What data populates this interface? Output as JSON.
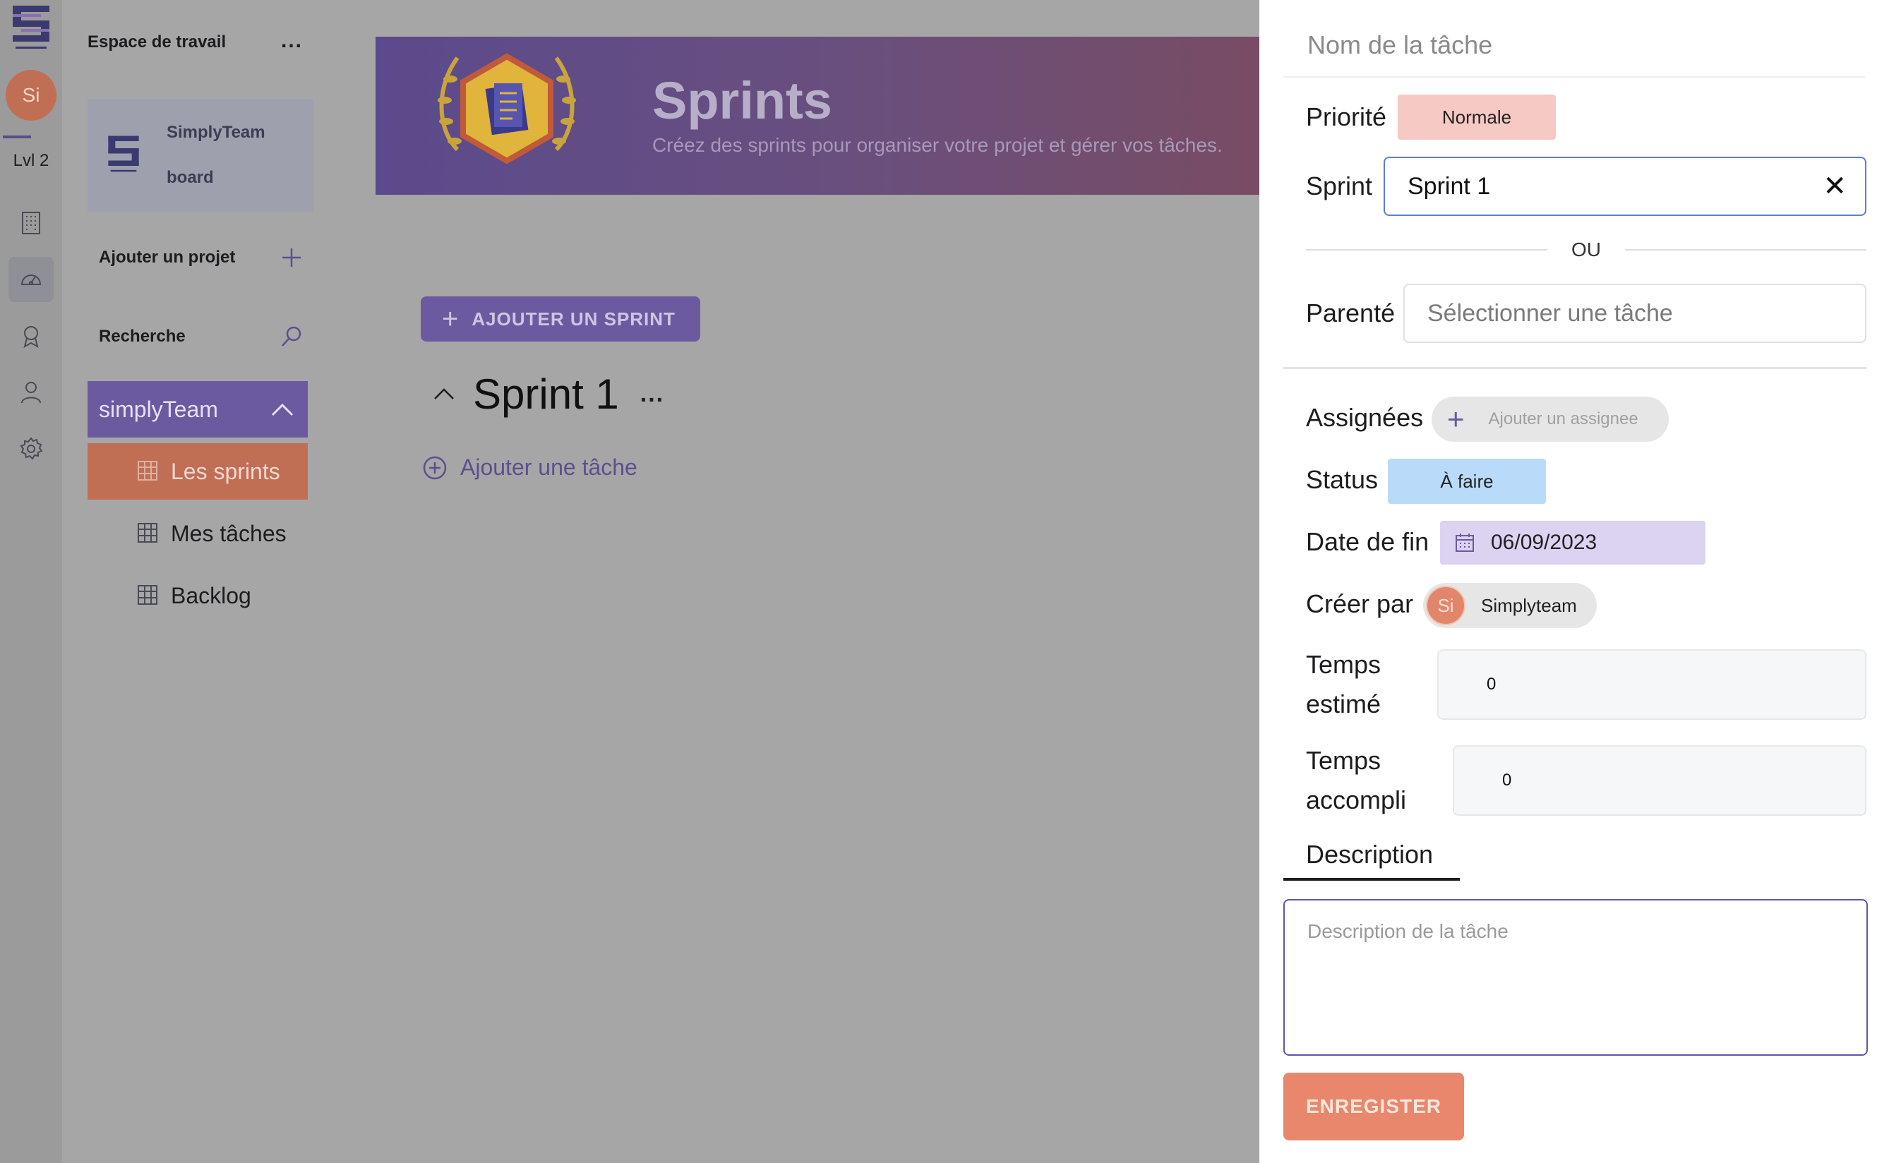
{
  "rail": {
    "avatar_initials": "Si",
    "level": "Lvl 2"
  },
  "sidebar": {
    "workspace_title": "Espace de travail",
    "workspace_menu": "...",
    "board": {
      "name_line1": "SimplyTeam",
      "name_line2": "board"
    },
    "add_project": "Ajouter un projet",
    "search": "Recherche",
    "team": "simplyTeam",
    "items": [
      {
        "label": "Les sprints",
        "active": true
      },
      {
        "label": "Mes tâches",
        "active": false
      },
      {
        "label": "Backlog",
        "active": false
      }
    ]
  },
  "main": {
    "banner_title": "Sprints",
    "banner_subtitle": "Créez des sprints pour organiser votre projet et gérer vos tâches.",
    "add_sprint_label": "AJOUTER UN SPRINT",
    "sprint_name": "Sprint 1",
    "sprint_menu": "...",
    "add_task_label": "Ajouter une tâche"
  },
  "drawer": {
    "task_name_placeholder": "Nom de la tâche",
    "priority_label": "Priorité",
    "priority_value": "Normale",
    "sprint_label": "Sprint",
    "sprint_value": "Sprint 1",
    "clear_symbol": "✕",
    "or_text": "OU",
    "parent_label": "Parenté",
    "parent_placeholder": "Sélectionner une tâche",
    "assignees_label": "Assignées",
    "add_assignee": "Ajouter un assignee",
    "status_label": "Status",
    "status_value": "À faire",
    "end_date_label": "Date de fin",
    "end_date_value": "06/09/2023",
    "created_by_label": "Créer par",
    "creator_initials": "Si",
    "creator_name": "Simplyteam",
    "estimated_label_1": "Temps",
    "estimated_label_2": "estimé",
    "estimated_value": "0",
    "completed_label_1": "Temps",
    "completed_label_2": "accompli",
    "completed_value": "0",
    "description_tab": "Description",
    "description_placeholder": "Description de la tâche",
    "save_label": "ENREGISTER"
  },
  "colors": {
    "primary_purple": "#6c5aa0",
    "accent_orange": "#e9876c",
    "priority_bg": "#f6c9c4",
    "status_bg": "#b9dbf9",
    "date_bg": "#dcd2f2"
  }
}
